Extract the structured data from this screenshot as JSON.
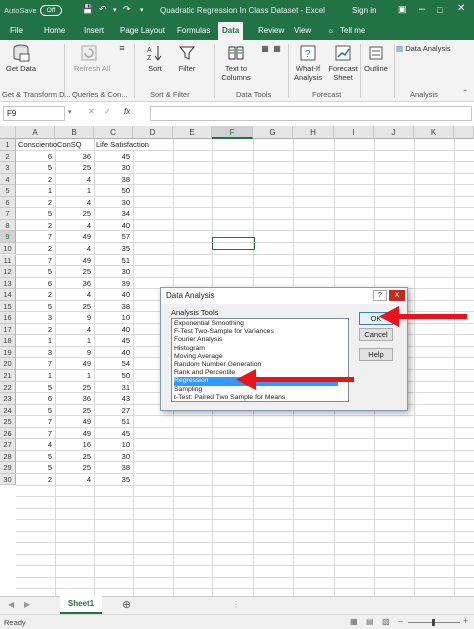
{
  "titlebar": {
    "autosave": "AutoSave",
    "autosave_state": "Off",
    "title": "Quadratic Regression In Class Dataset  -  Excel",
    "signin": "Sign in"
  },
  "tabs": [
    "File",
    "Home",
    "Insert",
    "Page Layout",
    "Formulas",
    "Data",
    "Review",
    "View"
  ],
  "active_tab": "Data",
  "tell_me": "Tell me",
  "ribbon": {
    "get_data": "Get Data",
    "refresh_all": "Refresh All",
    "sort": "Sort",
    "filter": "Filter",
    "text_to_columns": "Text to Columns",
    "what_if": "What-If Analysis",
    "forecast_sheet": "Forecast Sheet",
    "outline": "Outline",
    "data_analysis": "Data Analysis",
    "groups": [
      "Get & Transform D...",
      "Queries & Con...",
      "Sort & Filter",
      "Data Tools",
      "Forecast",
      "Analysis"
    ]
  },
  "namebox": "F9",
  "fx": "fx",
  "columns": [
    "A",
    "B",
    "C",
    "D",
    "E",
    "F",
    "G",
    "H",
    "I",
    "J",
    "K"
  ],
  "selected_column": "F",
  "selected_row": "9",
  "headers": {
    "a": "Conscientious",
    "b": "ConSQ",
    "c": "Life Satisfaction"
  },
  "rows": [
    {
      "r": "2",
      "a": "6",
      "b": "36",
      "c": "45"
    },
    {
      "r": "3",
      "a": "5",
      "b": "25",
      "c": "30"
    },
    {
      "r": "4",
      "a": "2",
      "b": "4",
      "c": "38"
    },
    {
      "r": "5",
      "a": "1",
      "b": "1",
      "c": "50"
    },
    {
      "r": "6",
      "a": "2",
      "b": "4",
      "c": "30"
    },
    {
      "r": "7",
      "a": "5",
      "b": "25",
      "c": "34"
    },
    {
      "r": "8",
      "a": "2",
      "b": "4",
      "c": "40"
    },
    {
      "r": "9",
      "a": "7",
      "b": "49",
      "c": "57"
    },
    {
      "r": "10",
      "a": "2",
      "b": "4",
      "c": "35"
    },
    {
      "r": "11",
      "a": "7",
      "b": "49",
      "c": "51"
    },
    {
      "r": "12",
      "a": "5",
      "b": "25",
      "c": "30"
    },
    {
      "r": "13",
      "a": "6",
      "b": "36",
      "c": "39"
    },
    {
      "r": "14",
      "a": "2",
      "b": "4",
      "c": "40"
    },
    {
      "r": "15",
      "a": "5",
      "b": "25",
      "c": "38"
    },
    {
      "r": "16",
      "a": "3",
      "b": "9",
      "c": "10"
    },
    {
      "r": "17",
      "a": "2",
      "b": "4",
      "c": "40"
    },
    {
      "r": "18",
      "a": "1",
      "b": "1",
      "c": "45"
    },
    {
      "r": "19",
      "a": "3",
      "b": "9",
      "c": "40"
    },
    {
      "r": "20",
      "a": "7",
      "b": "49",
      "c": "54"
    },
    {
      "r": "21",
      "a": "1",
      "b": "1",
      "c": "50"
    },
    {
      "r": "22",
      "a": "5",
      "b": "25",
      "c": "31"
    },
    {
      "r": "23",
      "a": "6",
      "b": "36",
      "c": "43"
    },
    {
      "r": "24",
      "a": "5",
      "b": "25",
      "c": "27"
    },
    {
      "r": "25",
      "a": "7",
      "b": "49",
      "c": "51"
    },
    {
      "r": "26",
      "a": "7",
      "b": "49",
      "c": "45"
    },
    {
      "r": "27",
      "a": "4",
      "b": "16",
      "c": "10"
    },
    {
      "r": "28",
      "a": "5",
      "b": "25",
      "c": "30"
    },
    {
      "r": "29",
      "a": "5",
      "b": "25",
      "c": "38"
    },
    {
      "r": "30",
      "a": "2",
      "b": "4",
      "c": "35"
    }
  ],
  "sheet_tab": "Sheet1",
  "status": "Ready",
  "dialog": {
    "title": "Data Analysis",
    "help_glyph": "?",
    "close_glyph": "X",
    "list_label": "Analysis Tools",
    "items": [
      "Exponential Smoothing",
      "F-Test Two-Sample for Variances",
      "Fourier Analysis",
      "Histogram",
      "Moving Average",
      "Random Number Generation",
      "Rank and Percentile",
      "Regression",
      "Sampling",
      "t-Test: Paired Two Sample for Means"
    ],
    "selected": "Regression",
    "ok": "OK",
    "cancel": "Cancel",
    "help": "Help"
  },
  "colors": {
    "excel_green": "#217346",
    "arrow_red": "#e8141b",
    "selection_blue": "#3399ff"
  }
}
